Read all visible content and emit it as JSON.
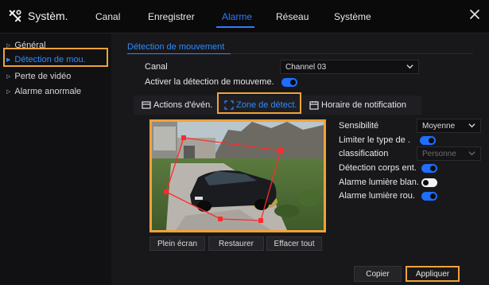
{
  "colors": {
    "accent": "#2e7bff",
    "highlight": "#f0a23a",
    "zone": "#ff2a2a",
    "background": "#0b0b0d"
  },
  "header": {
    "brand": "Systèm.",
    "nav": [
      "Canal",
      "Enregistrer",
      "Alarme",
      "Réseau",
      "Système"
    ],
    "active_nav": "Alarme"
  },
  "sidebar": {
    "items": [
      {
        "label": "Général",
        "icon": "triangle-right-icon"
      },
      {
        "label": "Détection de mou.",
        "icon": "triangle-right-icon",
        "active": true
      },
      {
        "label": "Perte de vidéo",
        "icon": "triangle-right-icon"
      },
      {
        "label": "Alarme anormale",
        "icon": "triangle-right-icon"
      }
    ]
  },
  "main": {
    "section_title": "Détection de mouvement",
    "canal_label": "Canal",
    "canal_value": "Channel 03",
    "enable_label": "Activer la détection de mouveme.",
    "tabs": [
      {
        "label": "Actions d'évén.",
        "icon": "actions-icon"
      },
      {
        "label": "Zone de détect.",
        "icon": "zone-icon",
        "active": true
      },
      {
        "label": "Horaire de notification",
        "icon": "calendar-icon"
      }
    ],
    "settings": {
      "sensibilite_label": "Sensibilité",
      "sensibilite_value": "Moyenne",
      "limit_type_label": "Limiter le type de .",
      "classification_label": "classification",
      "classification_value": "Personne",
      "corps_label": "Détection corps ent.",
      "lumiere_blanche_label": "Alarme lumière blan.",
      "lumiere_rouge_label": "Alarme lumière rou."
    },
    "video_buttons": [
      "Plein écran",
      "Restaurer",
      "Effacer tout"
    ],
    "footer": {
      "copy": "Copier",
      "apply": "Appliquer"
    }
  }
}
